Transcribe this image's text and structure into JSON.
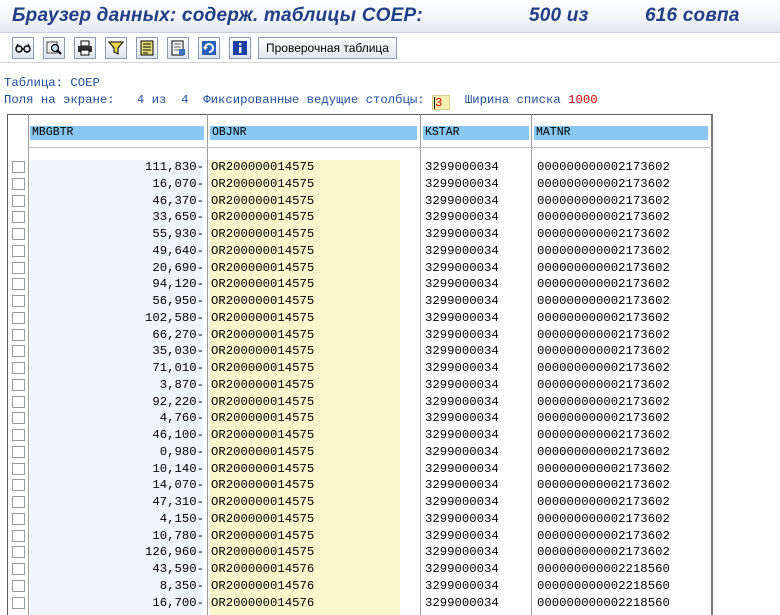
{
  "title": {
    "main": "Браузер данных: содерж. таблицы COEP:",
    "count": "500 из",
    "match": "616 совпа"
  },
  "toolbar": {
    "icons": [
      "glasses-icon",
      "magnifier-icon",
      "printer-icon",
      "filter-icon",
      "list-icon",
      "document-icon",
      "refresh-icon",
      "info-icon"
    ],
    "check_table_label": "Проверочная таблица"
  },
  "info": {
    "table_line": "Таблица: COEP",
    "fields_label": "Поля на экране:",
    "fields_value": "4 из  4",
    "fixed_label": "Фиксированные ведущие столбцы:",
    "fixed_value": "3",
    "width_label": "Ширина списка",
    "width_value": "1000"
  },
  "columns": [
    "MBGBTR",
    "OBJNR",
    "KSTAR",
    "MATNR"
  ],
  "rows": [
    [
      "111,830-",
      "OR200000014575",
      "3299000034",
      "000000000002173602"
    ],
    [
      "16,070-",
      "OR200000014575",
      "3299000034",
      "000000000002173602"
    ],
    [
      "46,370-",
      "OR200000014575",
      "3299000034",
      "000000000002173602"
    ],
    [
      "33,650-",
      "OR200000014575",
      "3299000034",
      "000000000002173602"
    ],
    [
      "55,930-",
      "OR200000014575",
      "3299000034",
      "000000000002173602"
    ],
    [
      "49,640-",
      "OR200000014575",
      "3299000034",
      "000000000002173602"
    ],
    [
      "20,690-",
      "OR200000014575",
      "3299000034",
      "000000000002173602"
    ],
    [
      "94,120-",
      "OR200000014575",
      "3299000034",
      "000000000002173602"
    ],
    [
      "56,950-",
      "OR200000014575",
      "3299000034",
      "000000000002173602"
    ],
    [
      "102,580-",
      "OR200000014575",
      "3299000034",
      "000000000002173602"
    ],
    [
      "66,270-",
      "OR200000014575",
      "3299000034",
      "000000000002173602"
    ],
    [
      "35,030-",
      "OR200000014575",
      "3299000034",
      "000000000002173602"
    ],
    [
      "71,010-",
      "OR200000014575",
      "3299000034",
      "000000000002173602"
    ],
    [
      "3,870-",
      "OR200000014575",
      "3299000034",
      "000000000002173602"
    ],
    [
      "92,220-",
      "OR200000014575",
      "3299000034",
      "000000000002173602"
    ],
    [
      "4,760-",
      "OR200000014575",
      "3299000034",
      "000000000002173602"
    ],
    [
      "46,100-",
      "OR200000014575",
      "3299000034",
      "000000000002173602"
    ],
    [
      "0,980-",
      "OR200000014575",
      "3299000034",
      "000000000002173602"
    ],
    [
      "10,140-",
      "OR200000014575",
      "3299000034",
      "000000000002173602"
    ],
    [
      "14,070-",
      "OR200000014575",
      "3299000034",
      "000000000002173602"
    ],
    [
      "47,310-",
      "OR200000014575",
      "3299000034",
      "000000000002173602"
    ],
    [
      "4,150-",
      "OR200000014575",
      "3299000034",
      "000000000002173602"
    ],
    [
      "10,780-",
      "OR200000014575",
      "3299000034",
      "000000000002173602"
    ],
    [
      "126,960-",
      "OR200000014575",
      "3299000034",
      "000000000002173602"
    ],
    [
      "43,590-",
      "OR200000014576",
      "3299000034",
      "000000000002218560"
    ],
    [
      "8,350-",
      "OR200000014576",
      "3299000034",
      "000000000002218560"
    ],
    [
      "16,700-",
      "OR200000014576",
      "3299000034",
      "000000000002218560"
    ]
  ]
}
